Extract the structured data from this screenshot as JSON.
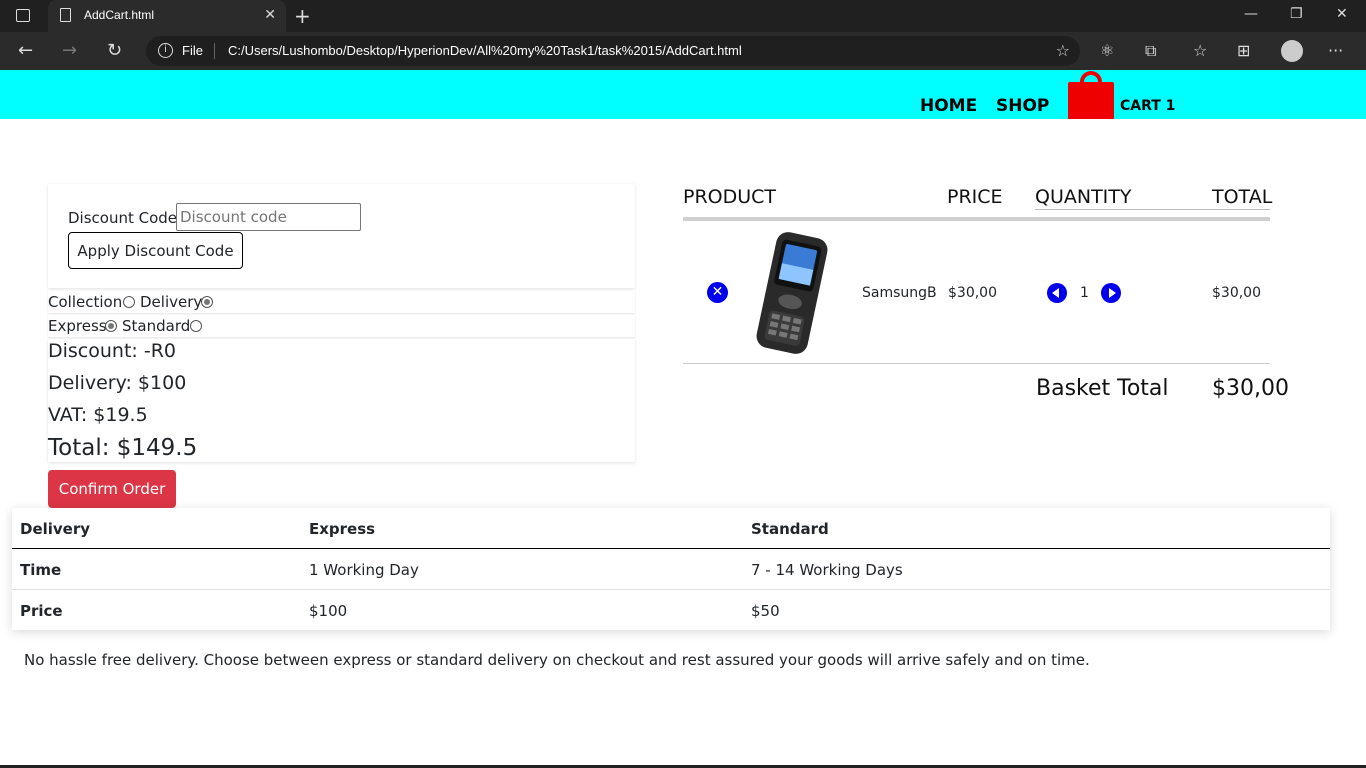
{
  "browser": {
    "tab_title": "AddCart.html",
    "tab_close": "✕",
    "new_tab": "+",
    "file_label": "File",
    "url": "C:/Users/Lushombo/Desktop/HyperionDev/All%20my%20Task1/task%2015/AddCart.html",
    "back": "←",
    "forward": "→",
    "reload": "↻",
    "minimize": "—",
    "restore": "❐",
    "close": "✕",
    "favorites_add": "☆",
    "menu": "···"
  },
  "header": {
    "nav": [
      "HOME",
      "SHOP"
    ],
    "cart_label": "CART 1"
  },
  "discount": {
    "label": "Discount Code",
    "placeholder": "Discount code",
    "apply_label": "Apply Discount Code"
  },
  "shipping_method": {
    "options": [
      {
        "label": "Collection",
        "checked": false
      },
      {
        "label": "Delivery",
        "checked": true
      }
    ]
  },
  "delivery_speed": {
    "options": [
      {
        "label": "Express",
        "checked": true
      },
      {
        "label": "Standard",
        "checked": false
      }
    ]
  },
  "summary": {
    "discount": "Discount: -R0",
    "delivery": "Delivery: $100",
    "vat": "VAT: $19.5",
    "total": "Total: $149.5"
  },
  "confirm_label": "Confirm Order",
  "cart": {
    "headers": [
      "PRODUCT",
      "PRICE",
      "QUANTITY",
      "TOTAL"
    ],
    "item": {
      "name": "SamsungB",
      "price": "$30,00",
      "quantity": "1",
      "total": "$30,00"
    },
    "basket_total_label": "Basket Total",
    "basket_total_value": "$30,00"
  },
  "delivery_table": {
    "headers": [
      "Delivery",
      "Express",
      "Standard"
    ],
    "rows": [
      [
        "Time",
        "1 Working Day",
        "7 - 14 Working Days"
      ],
      [
        "Price",
        "$100",
        "$50"
      ]
    ]
  },
  "footnote": "No hassle free delivery. Choose between express or standard delivery on checkout and rest assured your goods will arrive safely and on time."
}
